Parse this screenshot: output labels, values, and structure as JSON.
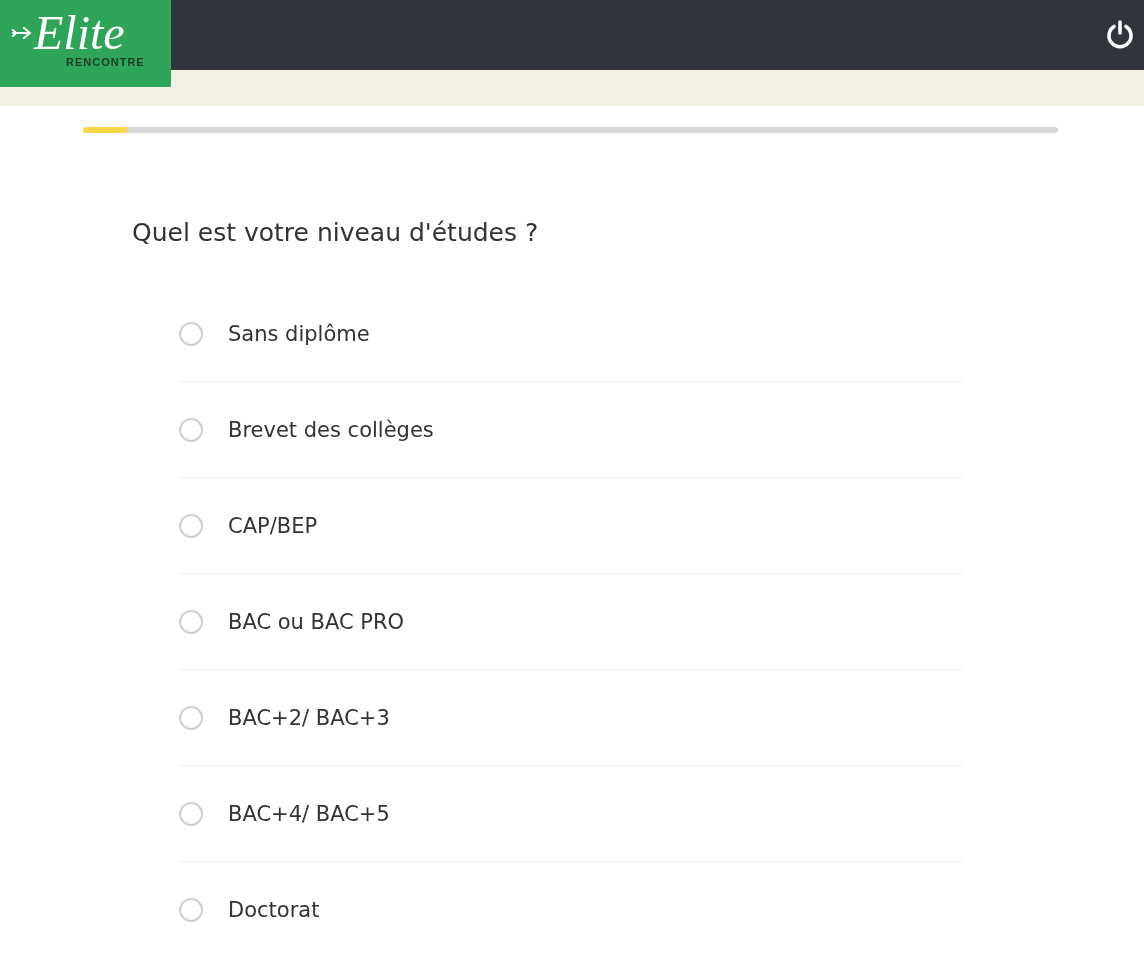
{
  "header": {
    "logo": {
      "name": "Elite",
      "tagline": "RENCONTRE"
    }
  },
  "progress": {
    "level": 0.045
  },
  "question": "Quel est votre niveau d'études ?",
  "options": [
    {
      "label": "Sans diplôme",
      "selected": false
    },
    {
      "label": "Brevet des collèges",
      "selected": false
    },
    {
      "label": "CAP/BEP",
      "selected": false
    },
    {
      "label": "BAC ou BAC PRO",
      "selected": false
    },
    {
      "label": "BAC+2/ BAC+3",
      "selected": false
    },
    {
      "label": "BAC+4/ BAC+5",
      "selected": false
    },
    {
      "label": "Doctorat",
      "selected": false
    }
  ]
}
